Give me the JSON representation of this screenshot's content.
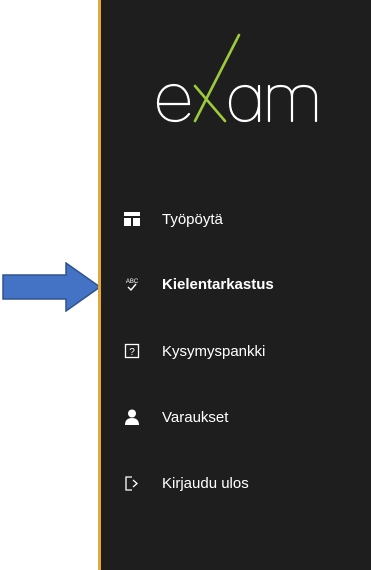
{
  "logo": {
    "text": "exam",
    "icon": "exam-logo",
    "color": "#ffffff",
    "accent": "#9ccb3b"
  },
  "nav": {
    "items": [
      {
        "label": "Työpöytä",
        "icon": "dashboard-icon",
        "active": false
      },
      {
        "label": "Kielentarkastus",
        "icon": "spellcheck-icon",
        "active": true
      },
      {
        "label": "Kysymyspankki",
        "icon": "question-box-icon",
        "active": false
      },
      {
        "label": "Varaukset",
        "icon": "user-icon",
        "active": false
      },
      {
        "label": "Kirjaudu ulos",
        "icon": "logout-icon",
        "active": false
      }
    ]
  },
  "spellcheck_icon_text": "ABC",
  "question_icon_text": "?",
  "colors": {
    "sidebar_bg": "#1e1e1e",
    "sidebar_border": "#e0a93a",
    "arrow_fill": "#4472c4",
    "arrow_stroke": "#2f528f"
  }
}
